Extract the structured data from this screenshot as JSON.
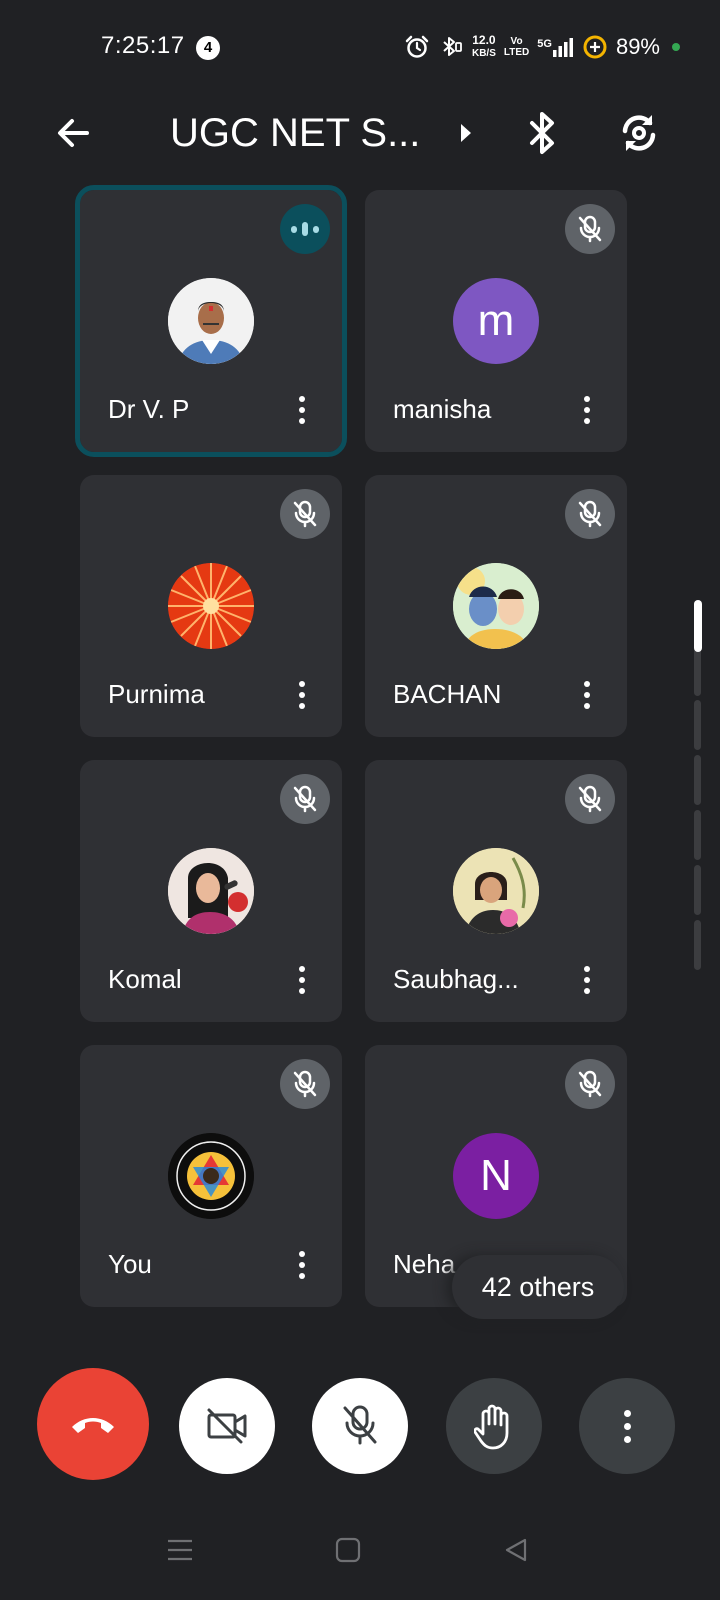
{
  "status_bar": {
    "time": "7:25:17",
    "notification_count": "4",
    "net_speed_value": "12.0",
    "net_speed_unit": "KB/S",
    "volte_top": "Vo",
    "volte_bottom": "LTED",
    "network": "5G",
    "battery": "89%"
  },
  "header": {
    "title": "UGC NET S..."
  },
  "participants": [
    {
      "name": "Dr V. P",
      "avatar_type": "photo",
      "state": "speaking"
    },
    {
      "name": "manisha",
      "avatar_type": "letter",
      "letter": "m",
      "color": "#7e57c2",
      "state": "muted"
    },
    {
      "name": "Purnima",
      "avatar_type": "photo",
      "state": "muted"
    },
    {
      "name": "BACHAN",
      "avatar_type": "photo",
      "state": "muted"
    },
    {
      "name": "Komal",
      "avatar_type": "photo",
      "state": "muted"
    },
    {
      "name": "Saubhag...",
      "avatar_type": "photo",
      "state": "muted"
    },
    {
      "name": "You",
      "avatar_type": "photo",
      "state": "muted"
    },
    {
      "name": "Neha",
      "avatar_type": "letter",
      "letter": "N",
      "color": "#7b1fa2",
      "state": "muted"
    }
  ],
  "others_chip": "42 others",
  "controls": [
    "end-call",
    "camera-off",
    "microphone-off",
    "raise-hand",
    "more-options"
  ],
  "colors": {
    "background": "#202124",
    "tile": "#2f3034",
    "active_outline": "#0b4f5c",
    "end_call": "#ea4335",
    "battery_dot": "#34a853"
  }
}
